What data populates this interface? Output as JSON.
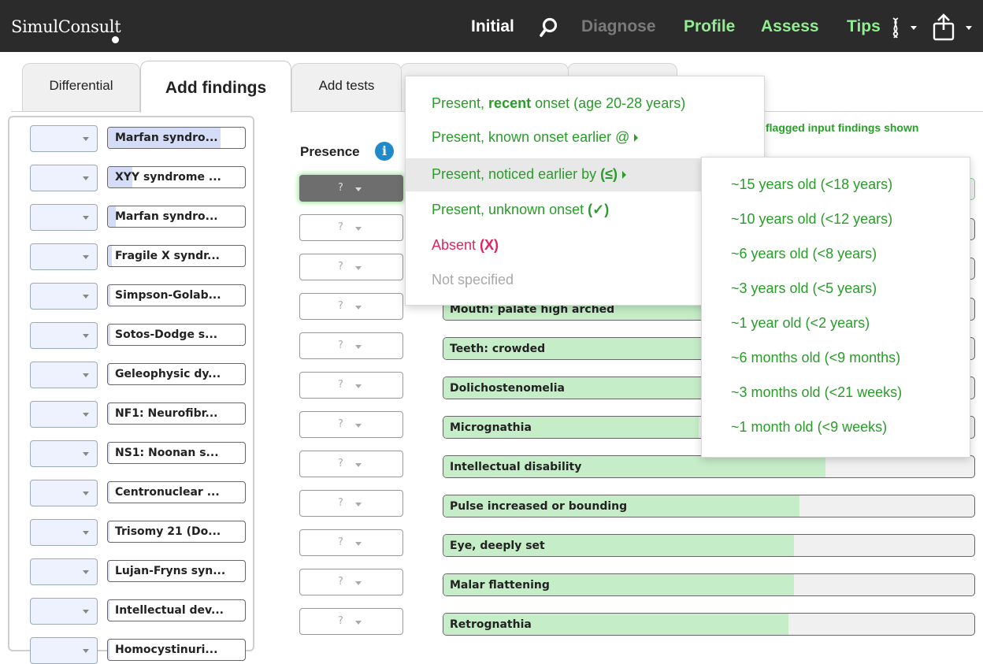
{
  "header": {
    "logo": "SimulConsult",
    "nav": {
      "initial": "Initial",
      "diagnose": "Diagnose",
      "profile": "Profile",
      "assess": "Assess",
      "tips": "Tips"
    },
    "icons": [
      "search-icon",
      "dna-icon",
      "share-icon"
    ]
  },
  "tabs": [
    {
      "label": "Differential"
    },
    {
      "label": "Add findings",
      "active": true
    },
    {
      "label": "Add tests"
    }
  ],
  "sidebar": {
    "items": [
      {
        "label": "Marfan syndro...",
        "score": 0.82
      },
      {
        "label": "XYY syndrome ...",
        "score": 0.18
      },
      {
        "label": "Marfan syndro...",
        "score": 0.06
      },
      {
        "label": "Fragile X syndr...",
        "score": 0.03
      },
      {
        "label": "Simpson-Golab...",
        "score": 0.02
      },
      {
        "label": "Sotos-Dodge s...",
        "score": 0.02
      },
      {
        "label": "Geleophysic dy...",
        "score": 0.01
      },
      {
        "label": "NF1: Neurofibr...",
        "score": 0.01
      },
      {
        "label": "NS1: Noonan s...",
        "score": 0.01
      },
      {
        "label": "Centronuclear ...",
        "score": 0.01
      },
      {
        "label": "Trisomy 21 (Do...",
        "score": 0.01
      },
      {
        "label": "Lujan-Fryns syn...",
        "score": 0.01
      },
      {
        "label": "Intellectual dev...",
        "score": 0.01
      },
      {
        "label": "Homocystinuri...",
        "score": 0.01
      }
    ]
  },
  "main": {
    "presence_label": "Presence",
    "info_icon": "i",
    "flag_note": "flagged input findings shown",
    "presence_value": "?",
    "findings": [
      {
        "label": "Mouth: palate high arched",
        "score": 0.56
      },
      {
        "label": "Teeth: crowded",
        "score": 0.52
      },
      {
        "label": "Dolichostenomelia",
        "score": 0.5
      },
      {
        "label": "Micrognathia",
        "score": 0.48
      },
      {
        "label": "Intellectual disability",
        "score": 0.72
      },
      {
        "label": "Pulse increased or bounding",
        "score": 0.67
      },
      {
        "label": "Eye, deeply set",
        "score": 0.66
      },
      {
        "label": "Malar flattening",
        "score": 0.66
      },
      {
        "label": "Retrognathia",
        "score": 0.65
      }
    ]
  },
  "presence_menu": {
    "items": {
      "recent_prefix": "Present, ",
      "recent_bold": "recent",
      "recent_suffix": " onset (age 20-28 years)",
      "known": "Present, known onset earlier @",
      "noticed_prefix": "Present, noticed earlier by ",
      "noticed_bold": "(≤)",
      "unknown_prefix": "Present, unknown onset ",
      "unknown_bold": "(✓)",
      "absent_prefix": "Absent ",
      "absent_bold": "(X)",
      "not_specified": "Not specified"
    }
  },
  "age_submenu": {
    "items": [
      "~15 years old (<18 years)",
      "~10 years old (<12 years)",
      "~6 years old (<8 years)",
      "~3 years old (<5 years)",
      "~1 year old (<2 years)",
      "~6 months old (<9 months)",
      "~3 months old (<21 weeks)",
      "~1 month old (<9 weeks)"
    ]
  },
  "colors": {
    "header_bg": "#2b2b2b",
    "nav_active": "#90ee90",
    "nav_disabled": "#7a7a7a",
    "menu_green": "#2a9c2a",
    "menu_red": "#e0245e",
    "finding_fill": "#c5edc8",
    "diagnosis_fill": "#d5dcf8"
  }
}
